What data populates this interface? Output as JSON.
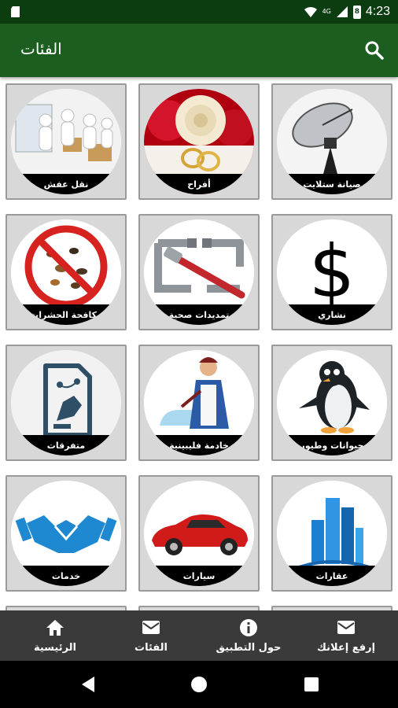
{
  "status_bar": {
    "time": "4:23",
    "network": "4G",
    "battery_level": "8"
  },
  "app_bar": {
    "title": "الفئات"
  },
  "categories": [
    {
      "label": "نقل عفش",
      "icon": "moving-people-icon"
    },
    {
      "label": "أفراح",
      "icon": "wedding-rings-icon"
    },
    {
      "label": "صيانة ستلايت",
      "icon": "satellite-dish-icon"
    },
    {
      "label": "مكافحة الحشرات",
      "icon": "no-insects-icon"
    },
    {
      "label": "تمديدات صحية",
      "icon": "pipe-wrench-icon"
    },
    {
      "label": "نشاري",
      "icon": "dollar-sign-icon"
    },
    {
      "label": "متفرقات",
      "icon": "document-pen-icon"
    },
    {
      "label": "خادمة فليبينية",
      "icon": "maid-icon"
    },
    {
      "label": "حيوانات وطيور",
      "icon": "penguin-icon"
    },
    {
      "label": "خدمات",
      "icon": "handshake-icon"
    },
    {
      "label": "سيارات",
      "icon": "red-car-icon"
    },
    {
      "label": "عقارات",
      "icon": "buildings-icon"
    }
  ],
  "bottom_nav": {
    "home": "الرئيسية",
    "categories": "الفئات",
    "about": "حول التطبيق",
    "post_ad": "إرفع إعلانك"
  },
  "colors": {
    "app_bar": "#1b5e20",
    "status_bar": "#0c3d10",
    "bottom_nav": "#3a3a3a"
  }
}
